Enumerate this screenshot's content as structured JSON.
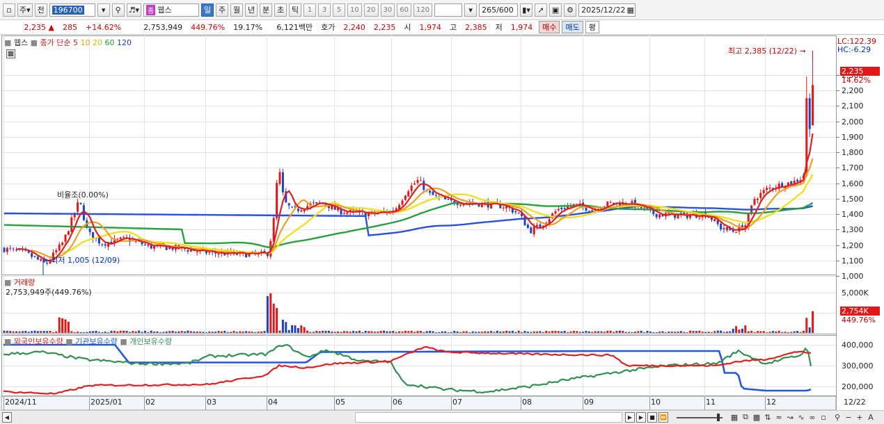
{
  "toolbar": {
    "market": "주",
    "prev_label": "전",
    "code": "196700",
    "stock_tag": "종",
    "stock_name": "웹스",
    "periods": [
      "일",
      "주",
      "월",
      "년",
      "분",
      "초",
      "틱"
    ],
    "active_period": "일",
    "intervals": [
      "1",
      "3",
      "5",
      "10",
      "20",
      "30",
      "60",
      "120"
    ],
    "count": "265",
    "count_total": "/600",
    "date": "2025/12/22"
  },
  "quote": {
    "price": "2,235",
    "arrow": "▲",
    "change": "285",
    "change_pct": "+14.62%",
    "volume": "2,753,949",
    "volume_pct": "449.76%",
    "turnover_pct": "19.17%",
    "amount": "6,121백만",
    "bid_label": "호가",
    "ask": "2,240",
    "bid": "2,235",
    "open_label": "시",
    "open": "1,974",
    "high_label": "고",
    "high": "2,385",
    "low_label": "저",
    "low": "1,974",
    "buy_button": "매수",
    "sell_button": "매도",
    "avg_button": "평"
  },
  "legend": {
    "name": "웹스",
    "ma_label": "종가 단순",
    "ma_periods": [
      "5",
      "10",
      "20",
      "60",
      "120"
    ],
    "ma_colors": [
      "#e02020",
      "#f0a000",
      "#e8d800",
      "#20a040",
      "#2040d0"
    ]
  },
  "price_axis": {
    "lc": "LC:122.39",
    "hc": "HC:-6.29",
    "ticks": [
      "2,300",
      "2,200",
      "2,100",
      "2,000",
      "1,900",
      "1,800",
      "1,700",
      "1,600",
      "1,500",
      "1,400",
      "1,300",
      "1,200",
      "1,100",
      "1,000"
    ],
    "current": "2,235",
    "current_pct": "14.62%"
  },
  "annotations": {
    "max_label": "최고 2,385 (12/22)",
    "min_label": "최저 1,005 (12/09)",
    "ratio_label": "비율조(0.00%)"
  },
  "volume_panel": {
    "title": "거래량",
    "value": "2,753,949주(449.76%)",
    "tick": "5,000K",
    "current": "2,754K",
    "current_pct": "449.76%"
  },
  "holdings_panel": {
    "foreign": "외국인보유수량",
    "institution": "기관보유수량",
    "individual": "개인보유수량",
    "ticks": [
      "400,000",
      "300,000",
      "200,000"
    ]
  },
  "x_axis": {
    "labels": [
      "2024/11",
      "2025/01",
      "02",
      "03",
      "04",
      "05",
      "06",
      "07",
      "08",
      "09",
      "10",
      "11",
      "12"
    ],
    "end_label": "12/22"
  },
  "colors": {
    "up": "#d40000",
    "down": "#0030c8",
    "foreign_line": "#e02020",
    "institution_line": "#2058e0",
    "individual_line": "#309050"
  }
}
